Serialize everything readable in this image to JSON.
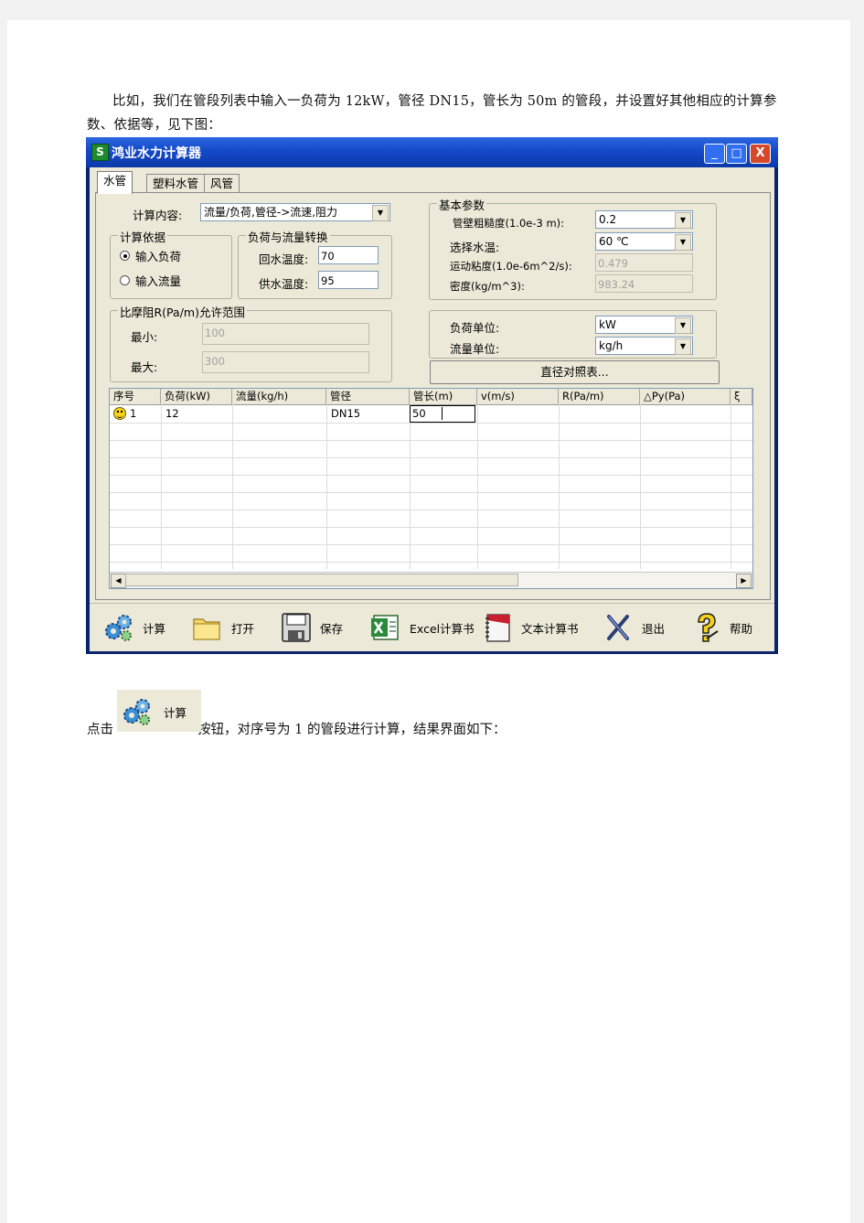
{
  "intro_text": "比如，我们在管段列表中输入一负荷为 12kW，管径 DN15，管长为 50m 的管段，并设置好其他相应的计算参数、依据等，见下图：",
  "window": {
    "title": "鸿业水力计算器",
    "controls": [
      "_",
      "□",
      "X"
    ]
  },
  "tabs": [
    "水管",
    "塑料水管",
    "风管"
  ],
  "calc_content": {
    "label": "计算内容:",
    "value": "流量/负荷,管径->流速,阻力"
  },
  "calc_basis": {
    "title": "计算依据",
    "options": [
      {
        "label": "输入负荷",
        "selected": true
      },
      {
        "label": "输入流量",
        "selected": false
      }
    ]
  },
  "load_flow": {
    "title": "负荷与流量转换",
    "return_temp_label": "回水温度:",
    "return_temp_value": "70",
    "supply_temp_label": "供水温度:",
    "supply_temp_value": "95"
  },
  "friction_range": {
    "title": "比摩阻R(Pa/m)允许范围",
    "min_label": "最小:",
    "min_value": "100",
    "max_label": "最大:",
    "max_value": "300"
  },
  "basic_params": {
    "title": "基本参数",
    "roughness_label": "管壁粗糙度(1.0e-3 m):",
    "roughness_value": "0.2",
    "water_temp_label": "选择水温:",
    "water_temp_value": "60 ℃",
    "viscosity_label": "运动粘度(1.0e-6m^2/s):",
    "viscosity_value": "0.479",
    "density_label": "密度(kg/m^3):",
    "density_value": "983.24"
  },
  "units": {
    "load_label": "负荷单位:",
    "load_value": "kW",
    "flow_label": "流量单位:",
    "flow_value": "kg/h"
  },
  "diameter_button": "直径对照表...",
  "grid": {
    "columns": [
      "序号",
      "负荷(kW)",
      "流量(kg/h)",
      "管径",
      "管长(m)",
      "v(m/s)",
      "R(Pa/m)",
      "△Py(Pa)",
      "ξ"
    ],
    "rows": [
      {
        "no": "1",
        "load": "12",
        "flow": "",
        "diameter": "DN15",
        "length": "50"
      }
    ]
  },
  "toolbar": [
    {
      "label": "计算",
      "icon": "gears-icon"
    },
    {
      "label": "打开",
      "icon": "folder-icon"
    },
    {
      "label": "保存",
      "icon": "floppy-icon"
    },
    {
      "label": "Excel计算书",
      "icon": "excel-icon"
    },
    {
      "label": "文本计算书",
      "icon": "notebook-icon"
    },
    {
      "label": "退出",
      "icon": "exit-icon"
    },
    {
      "label": "帮助",
      "icon": "help-icon"
    }
  ],
  "after_text": {
    "before": "点击",
    "button_label": "计算",
    "after": "按钮，对序号为 1 的管段进行计算，结果界面如下："
  },
  "colors": {
    "titlebar": "#1448c8",
    "window_face": "#ece9d8",
    "close_button": "#d7472a"
  }
}
